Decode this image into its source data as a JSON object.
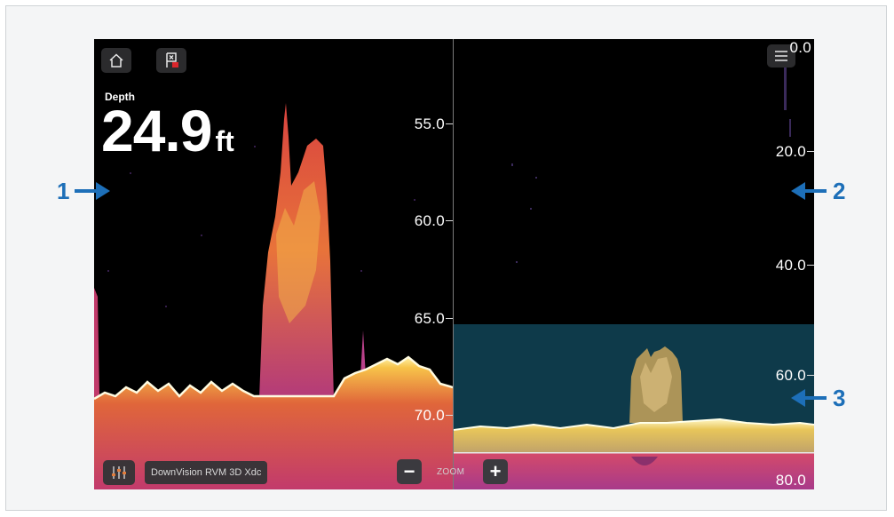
{
  "left_pane": {
    "depth_label": "Depth",
    "depth_value": "24.9",
    "depth_unit": "ft",
    "scale": [
      "55.0",
      "60.0",
      "65.0",
      "70.0"
    ],
    "source_label": "DownVision RVM 3D Xdc"
  },
  "right_pane": {
    "scale": [
      "0.0",
      "20.0",
      "40.0",
      "60.0",
      "80.0"
    ]
  },
  "zoom": {
    "label": "ZOOM",
    "minus": "−",
    "plus": "+"
  },
  "callouts": [
    "1",
    "2",
    "3"
  ],
  "icons": {
    "home": "home-icon",
    "waypoint": "waypoint-flag-icon",
    "menu": "menu-icon",
    "settings": "sliders-icon"
  },
  "colors": {
    "sonar_hot": "#f7c34a",
    "sonar_mid": "#d9433f",
    "sonar_low": "#8a2a7a",
    "zoom_window": "#0e3a4a",
    "callout": "#1d6fb8"
  }
}
